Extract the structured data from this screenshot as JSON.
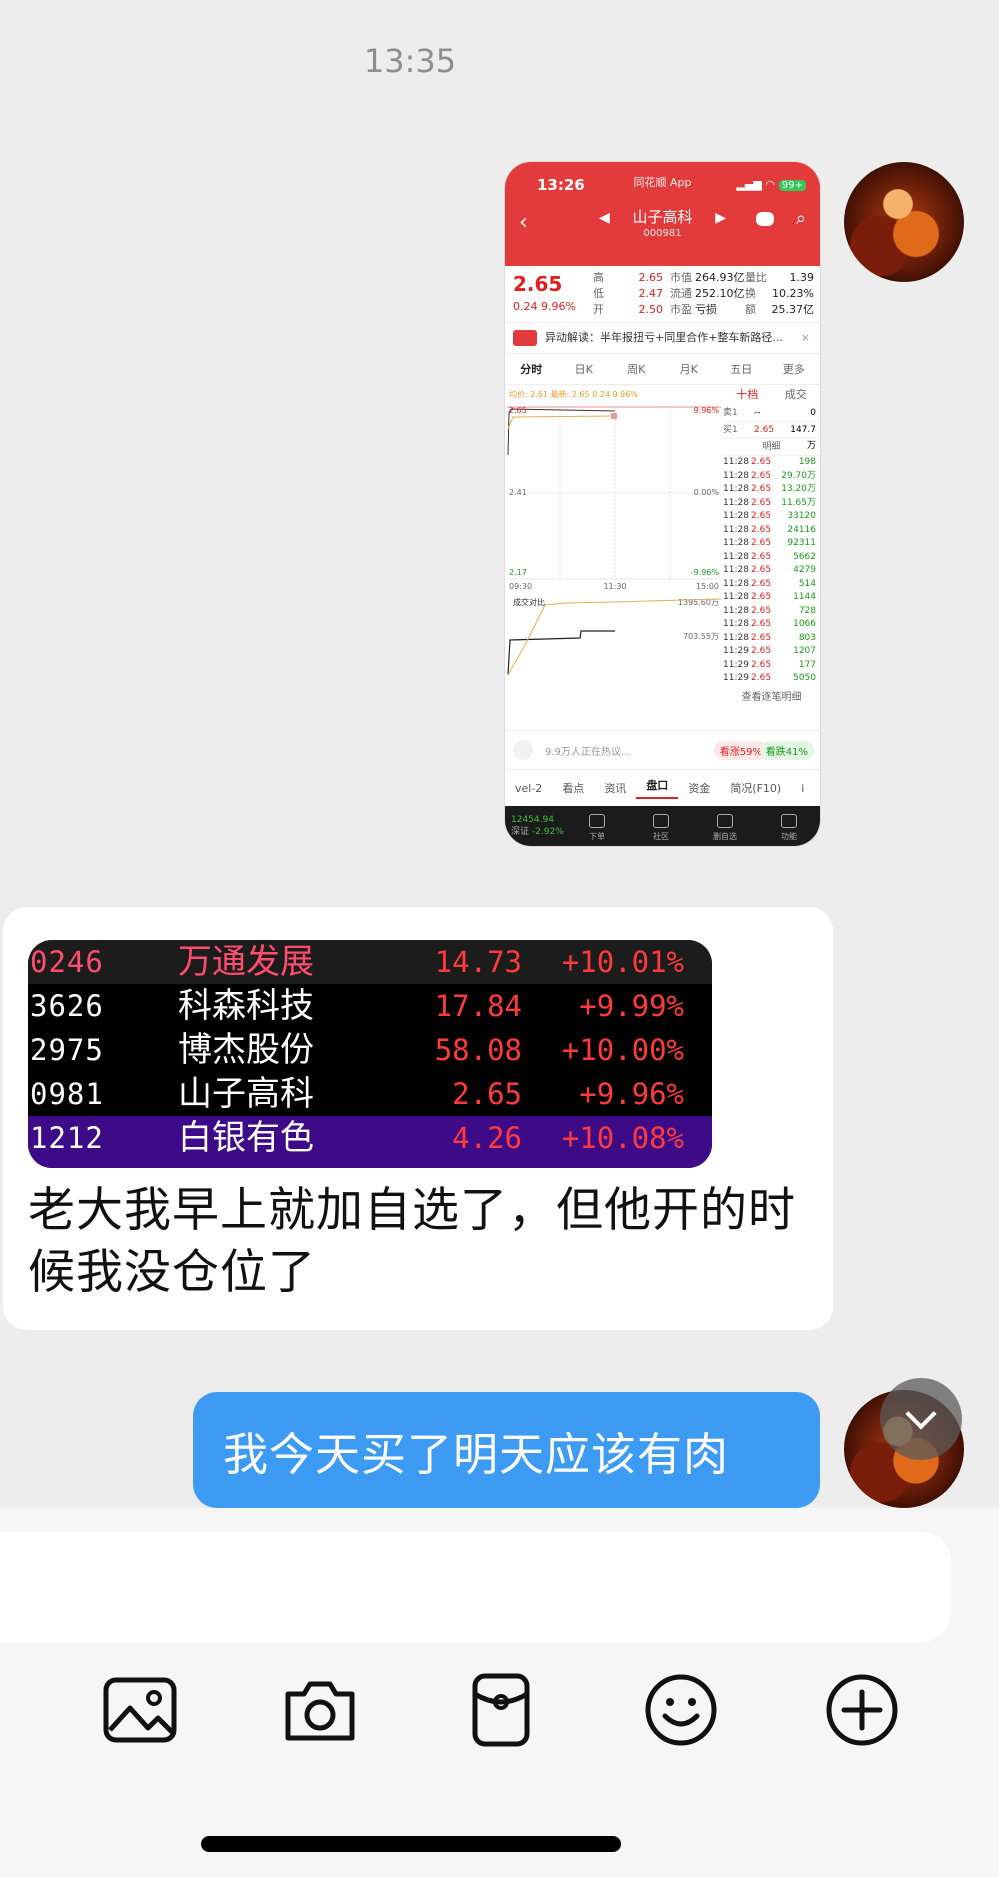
{
  "chat": {
    "timestamp": "13:35"
  },
  "shot": {
    "status_time": "13:26",
    "app_name": "同花顺 App",
    "battery": "99+",
    "stock_name": "山子高科",
    "stock_code": "000981",
    "price": "2.65",
    "change": "0.24",
    "change_pct": "9.96%",
    "high_label": "高",
    "high": "2.65",
    "low_label": "低",
    "low": "2.47",
    "open_label": "开",
    "open": "2.50",
    "mcap_label": "市值",
    "mcap": "264.93亿",
    "float_label": "流通",
    "float": "252.10亿",
    "pe_label": "市盈",
    "pe": "亏损",
    "vr_label": "量比",
    "vr": "1.39",
    "turn_label": "换",
    "turn": "10.23%",
    "amt_label": "额",
    "amt": "25.37亿",
    "anomaly_text": "异动解读：半年报扭亏+同里合作+整车新路径...",
    "chart_tabs": [
      "分时",
      "日K",
      "周K",
      "月K",
      "五日",
      "更多"
    ],
    "chart_header": "均价: 2.61  最新: 2.65  0.24  9.96%",
    "y_top": "2.65",
    "y_mid": "2.41",
    "y_bot": "2.17",
    "pct_top": "9.96%",
    "pct_mid": "0.00%",
    "pct_bot": "-9.96%",
    "t_start": "09:30",
    "t_mid": "11:30",
    "t_end": "15:00",
    "vol_label": "成交对比",
    "vol_top": "1395.60万",
    "vol_mid": "703.55万",
    "ladder_tabs": [
      "十档",
      "成交"
    ],
    "sell1_label": "卖1",
    "sell1_price": "--",
    "sell1_vol": "0",
    "buy1_label": "买1",
    "buy1_price": "2.65",
    "buy1_vol": "147.7万",
    "detail_label": "明细",
    "ticks": [
      {
        "t": "11:28",
        "p": "2.65",
        "v": "198"
      },
      {
        "t": "11:28",
        "p": "2.65",
        "v": "29.70万"
      },
      {
        "t": "11:28",
        "p": "2.65",
        "v": "13.20万"
      },
      {
        "t": "11:28",
        "p": "2.65",
        "v": "11.65万"
      },
      {
        "t": "11:28",
        "p": "2.65",
        "v": "33120"
      },
      {
        "t": "11:28",
        "p": "2.65",
        "v": "24116"
      },
      {
        "t": "11:28",
        "p": "2.65",
        "v": "92311"
      },
      {
        "t": "11:28",
        "p": "2.65",
        "v": "5662"
      },
      {
        "t": "11:28",
        "p": "2.65",
        "v": "4279"
      },
      {
        "t": "11:28",
        "p": "2.65",
        "v": "514"
      },
      {
        "t": "11:28",
        "p": "2.65",
        "v": "1144"
      },
      {
        "t": "11:28",
        "p": "2.65",
        "v": "728"
      },
      {
        "t": "11:28",
        "p": "2.65",
        "v": "1066"
      },
      {
        "t": "11:28",
        "p": "2.65",
        "v": "803"
      },
      {
        "t": "11:29",
        "p": "2.65",
        "v": "1207"
      },
      {
        "t": "11:29",
        "p": "2.65",
        "v": "177"
      },
      {
        "t": "11:29",
        "p": "2.65",
        "v": "5050"
      }
    ],
    "more_ticks": "查看逐笔明细",
    "discuss": "9.9万人正在热议...",
    "bull": "看涨59%",
    "bear": "看跌41%",
    "bottom_tabs": [
      "vel-2",
      "看点",
      "资讯",
      "盘口",
      "资金",
      "简况(F10)",
      "i"
    ],
    "index_value": "12454.94",
    "index_name": "深证",
    "index_change": "-2.92%",
    "nav_items": [
      "下单",
      "社区",
      "删自选",
      "功能"
    ]
  },
  "stock_list": [
    {
      "code": "0246",
      "name": "万通发展",
      "price": "14.73",
      "pct": "+10.01%"
    },
    {
      "code": "3626",
      "name": "科森科技",
      "price": "17.84",
      "pct": "+9.99%"
    },
    {
      "code": "2975",
      "name": "博杰股份",
      "price": "58.08",
      "pct": "+10.00%"
    },
    {
      "code": "0981",
      "name": "山子高科",
      "price": "2.65",
      "pct": "+9.96%"
    },
    {
      "code": "1212",
      "name": "白银有色",
      "price": "4.26",
      "pct": "+10.08%"
    }
  ],
  "incoming_text": "老大我早上就加自选了，但他开的时候我没仓位了",
  "outgoing_text": "我今天买了明天应该有肉",
  "toolbar": {
    "icons": [
      "image-icon",
      "camera-icon",
      "red-packet-icon",
      "emoji-icon",
      "plus-icon"
    ]
  },
  "colors": {
    "app_red": "#e33b3b",
    "bubble_blue": "#3d9bf4",
    "up_red": "#ff3a3a"
  }
}
